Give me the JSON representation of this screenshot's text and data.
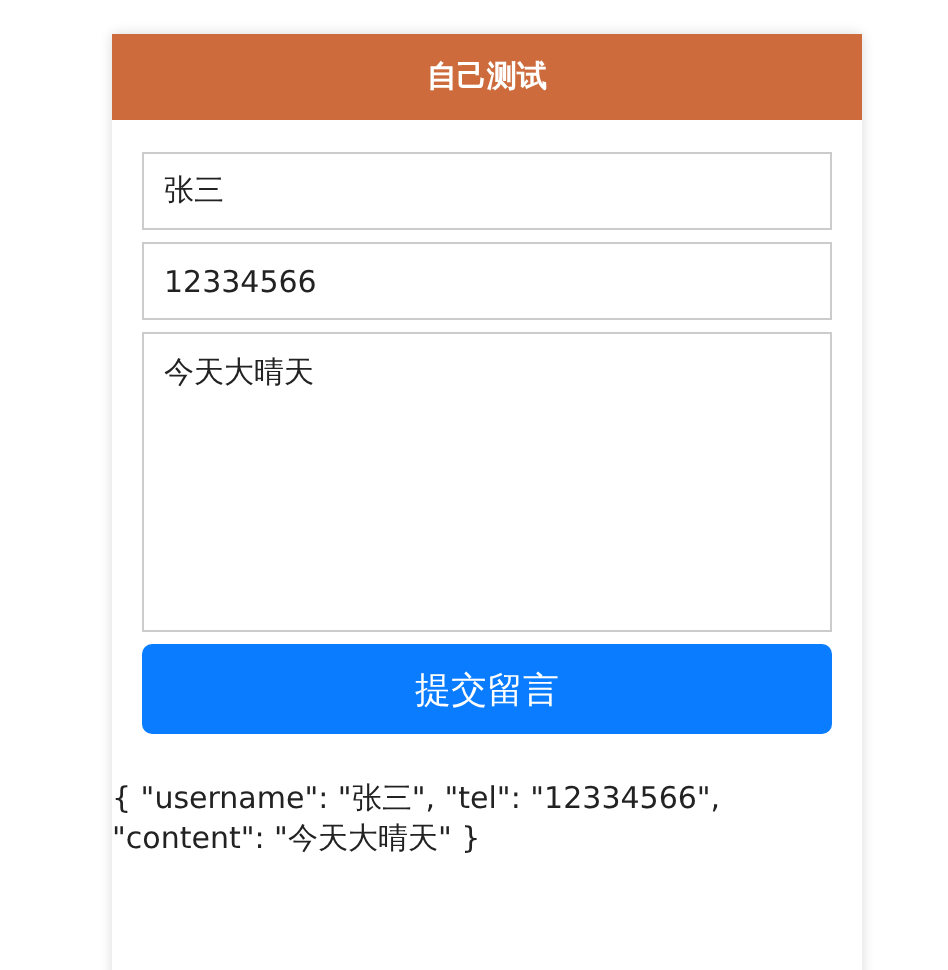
{
  "header": {
    "title": "自己测试"
  },
  "fields": [
    {
      "kind": "input",
      "value": "张三"
    },
    {
      "kind": "input",
      "value": "12334566"
    },
    {
      "kind": "textarea",
      "value": "今天大晴天"
    }
  ],
  "submit_button": {
    "label": "提交留言"
  },
  "output": "{ \"username\": \"张三\", \"tel\": \"12334566\", \"content\": \"今天大晴天\" }"
}
